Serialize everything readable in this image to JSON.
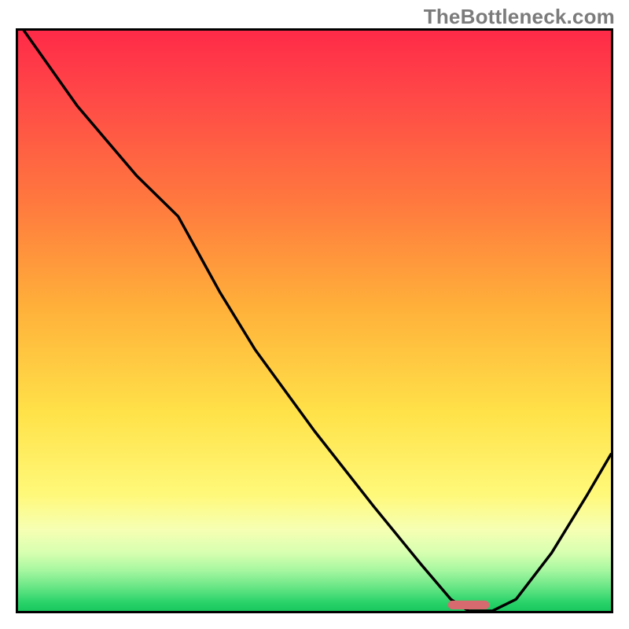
{
  "watermark": "TheBottleneck.com",
  "colors": {
    "gradient_top": "#ff2a48",
    "gradient_bottom": "#18c85e",
    "curve": "#000000",
    "marker": "#d66a6f",
    "frame": "#000000"
  },
  "chart_data": {
    "type": "line",
    "title": "",
    "xlabel": "",
    "ylabel": "",
    "xlim": [
      0,
      100
    ],
    "ylim": [
      0,
      100
    ],
    "grid": false,
    "legend": false,
    "note": "Black curve over vertical red→green gradient; V-shaped minimum near x≈76. Values are read off the plot area by proportion (no numeric axes shown).",
    "series": [
      {
        "name": "curve",
        "x": [
          1,
          10,
          20,
          27,
          34,
          40,
          50,
          60,
          68,
          73,
          76,
          80,
          84,
          90,
          96,
          100
        ],
        "values": [
          100,
          87,
          75,
          68,
          55,
          45,
          31,
          18,
          8,
          2,
          0,
          0,
          2,
          10,
          20,
          27
        ]
      }
    ],
    "marker": {
      "x": 76,
      "y": 0,
      "width_frac": 7,
      "height_frac": 1.5,
      "info": "Small rounded pink pill at the curve minimum on the baseline"
    }
  }
}
